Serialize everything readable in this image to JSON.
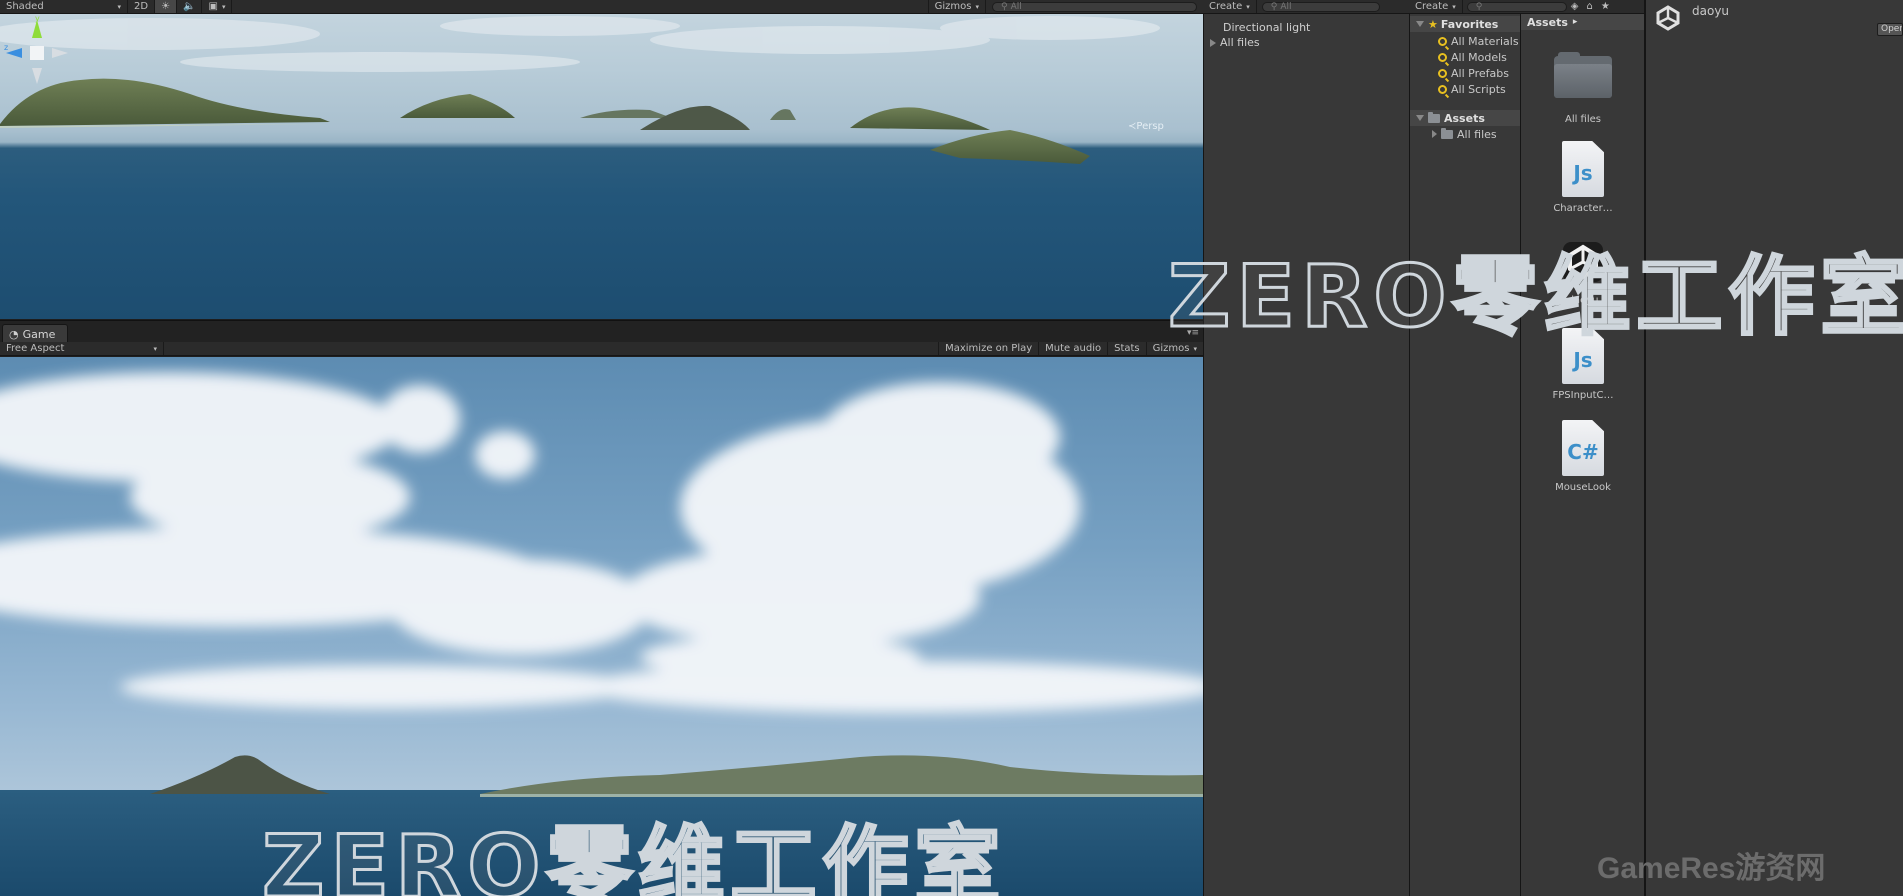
{
  "scene": {
    "toolbar": {
      "draw_mode": "Shaded",
      "mode_2d": "2D",
      "gizmos": "Gizmos",
      "search_placeholder": "All"
    },
    "persp_label": "Persp",
    "gizmo_axes": {
      "y": "y",
      "z": "z"
    }
  },
  "game": {
    "tab_label": "Game",
    "aspect": "Free Aspect",
    "maximize": "Maximize on Play",
    "mute": "Mute audio",
    "stats": "Stats",
    "gizmos": "Gizmos"
  },
  "hierarchy": {
    "create": "Create",
    "search_placeholder": "All",
    "items": [
      {
        "label": "Directional light"
      },
      {
        "label": "All files"
      }
    ]
  },
  "project": {
    "create": "Create",
    "favorites": {
      "label": "Favorites",
      "items": [
        "All Materials",
        "All Models",
        "All Prefabs",
        "All Scripts"
      ]
    },
    "assets_root": {
      "label": "Assets",
      "child": "All files"
    },
    "breadcrumb": "Assets",
    "assets": [
      {
        "label": "All files",
        "kind": "folder"
      },
      {
        "label": "Character…",
        "kind": "js",
        "glyph": "Js"
      },
      {
        "label": "daoyu",
        "kind": "unity-scene"
      },
      {
        "label": "FPSInputC…",
        "kind": "js",
        "glyph": "Js"
      },
      {
        "label": "MouseLook",
        "kind": "cs",
        "glyph": "C#"
      }
    ]
  },
  "inspector": {
    "title": "daoyu",
    "open_button": "Open"
  },
  "watermarks": {
    "main": "ZERO零维工作室",
    "corner": "GameRes游资网"
  },
  "colors": {
    "panel": "#383838",
    "toolbar": "#2b2b2b",
    "sea": "#1d4d70",
    "sky": "#76a0c2",
    "favorite_star": "#e8c020",
    "script_blue": "#3c8fc9"
  }
}
